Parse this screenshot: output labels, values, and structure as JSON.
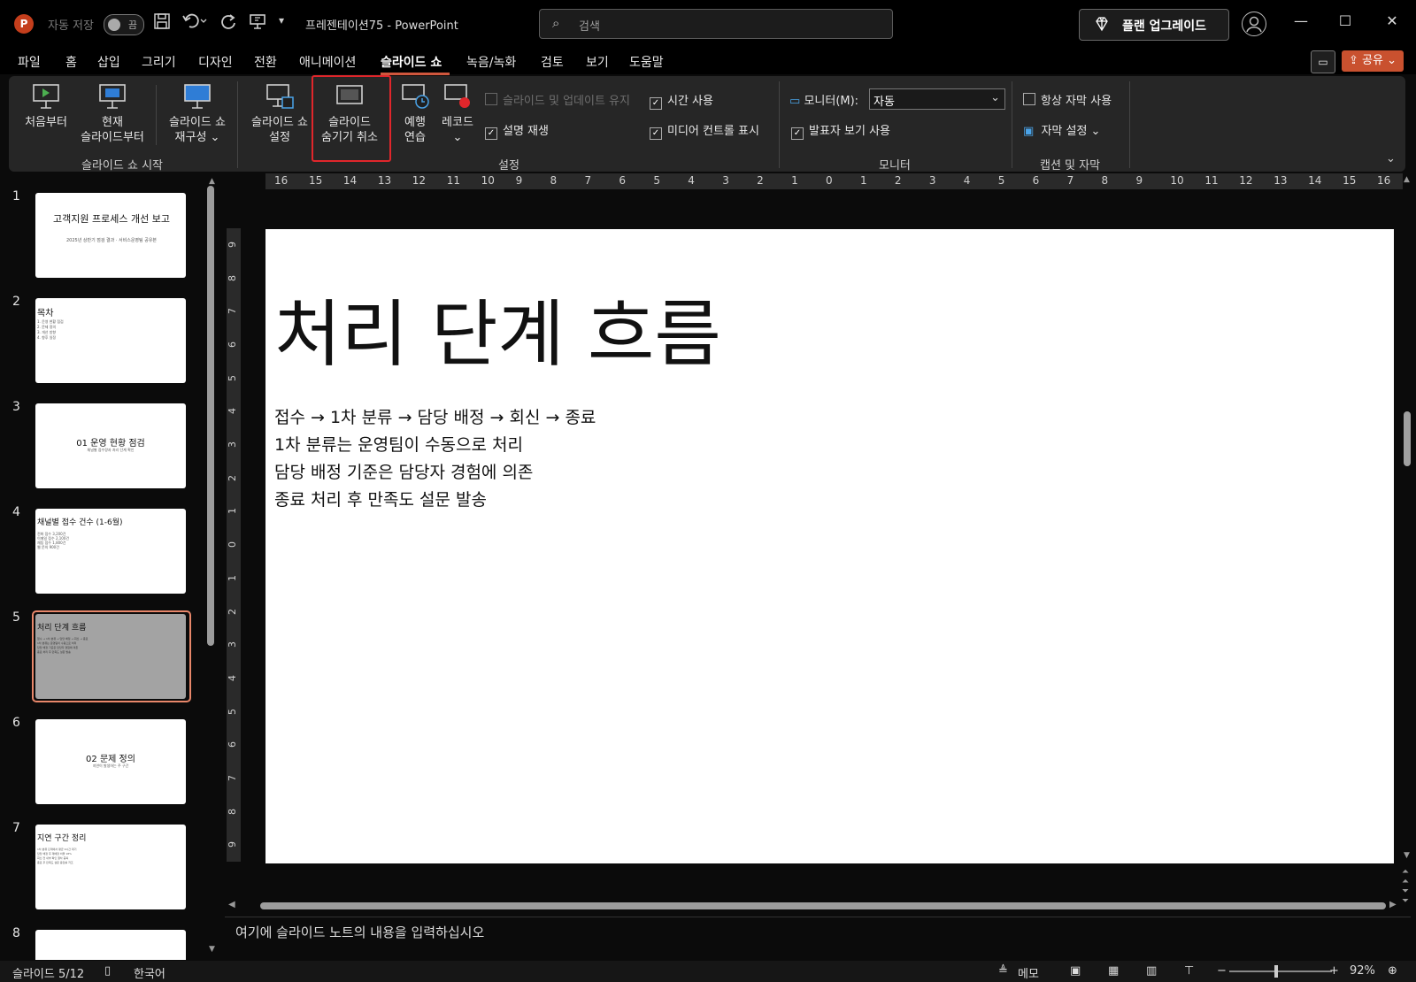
{
  "app": {
    "logo_letter": "P",
    "autosave_label": "자동 저장",
    "autosave_toggle": "끔",
    "title": "프레젠테이션75  -  PowerPoint",
    "search_placeholder": "검색",
    "upgrade_label": "플랜 업그레이드",
    "accent_color": "#c9512f"
  },
  "menu": {
    "items": [
      "파일",
      "홈",
      "삽입",
      "그리기",
      "디자인",
      "전환",
      "애니메이션",
      "슬라이드 쇼",
      "녹음/녹화",
      "검토",
      "보기",
      "도움말"
    ],
    "active": "슬라이드 쇼",
    "share_label": "공유"
  },
  "ribbon": {
    "start_group": {
      "label": "슬라이드 쇼 시작",
      "from_beginning": "처음부터",
      "from_current_1": "현재",
      "from_current_2": "슬라이드부터",
      "custom_1": "슬라이드 쇼",
      "custom_2": "재구성 ⌄"
    },
    "setup_group": {
      "label": "설정",
      "setup_1": "슬라이드 쇼",
      "setup_2": "설정",
      "unhide_1": "슬라이드",
      "unhide_2": "숨기기 취소",
      "rehearse_1": "예행",
      "rehearse_2": "연습",
      "record_1": "레코드",
      "record_2": "⌄",
      "keep_updated": "슬라이드 및 업데이트 유지",
      "play_narrations": "설명 재생",
      "use_timings": "시간 사용",
      "show_media_controls": "미디어 컨트롤 표시"
    },
    "monitor_group": {
      "label": "모니터",
      "monitor_label": "모니터(M):",
      "monitor_value": "자동",
      "presenter_view": "발표자 보기 사용"
    },
    "captions_group": {
      "label": "캡션 및 자막",
      "always_subtitles": "항상 자막 사용",
      "subtitle_settings": "자막 설정 ⌄"
    }
  },
  "ruler": {
    "h_ticks": [
      "16",
      "15",
      "14",
      "13",
      "12",
      "11",
      "10",
      "9",
      "8",
      "7",
      "6",
      "5",
      "4",
      "3",
      "2",
      "1",
      "0",
      "1",
      "2",
      "3",
      "4",
      "5",
      "6",
      "7",
      "8",
      "9",
      "10",
      "11",
      "12",
      "13",
      "14",
      "15",
      "16"
    ],
    "v_ticks": [
      "9",
      "8",
      "7",
      "6",
      "5",
      "4",
      "3",
      "2",
      "1",
      "0",
      "1",
      "2",
      "3",
      "4",
      "5",
      "6",
      "7",
      "8",
      "9"
    ]
  },
  "thumbnails": [
    {
      "num": "1",
      "title": "고객지원 프로세스 개선 보고",
      "sub": "2025년 상반기 점검 결과 · 서비스운영팀 공유본"
    },
    {
      "num": "2",
      "title": "목차",
      "sub": "1. 운영 현황 점검\n2. 문제 정의\n3. 개선 방향\n4. 향후 일정"
    },
    {
      "num": "3",
      "title": "01 운영 현황 점검",
      "sub": "채널별 접수량과 처리 단계 확인"
    },
    {
      "num": "4",
      "title": "채널별 접수 건수 (1-6월)",
      "sub": "전화 접수 3,200건\n이메일 접수 2,100건\n채팅 접수 1,800건\n웹 문의 900건"
    },
    {
      "num": "5",
      "title": "처리 단계 흐름",
      "sub": "접수 → 1차 분류 → 담당 배정 → 회신 → 종료\n1차 분류는 운영팀이 수동으로 처리\n담당 배정 기준은 담당자 경험에 의존\n종료 처리 후 만족도 설문 발송"
    },
    {
      "num": "6",
      "title": "02 문제 정의",
      "sub": "지연이 발생하는 주 구간"
    },
    {
      "num": "7",
      "title": "지연 구간 정리",
      "sub": "1차 분류 단계에서 평균 4시간 대기\n담당 배정 후 재배정 비율 18%\n회신 전 내부 확인 절차 중복\n종료 후 만족도 설문 응답률 저조"
    },
    {
      "num": "8",
      "title": "",
      "sub": ""
    }
  ],
  "slide": {
    "title": "처리 단계 흐름",
    "lines": [
      "접수 → 1차 분류 → 담당 배정 → 회신 → 종료",
      "1차 분류는 운영팀이 수동으로 처리",
      "담당 배정 기준은 담당자 경험에 의존",
      "종료 처리 후 만족도 설문 발송"
    ]
  },
  "notes_placeholder": "여기에 슬라이드 노트의 내용을 입력하십시오",
  "status": {
    "slide_indicator": "슬라이드 5/12",
    "language": "한국어",
    "notes_label": "메모",
    "zoom": "92%",
    "zoom_level": 0.46
  }
}
